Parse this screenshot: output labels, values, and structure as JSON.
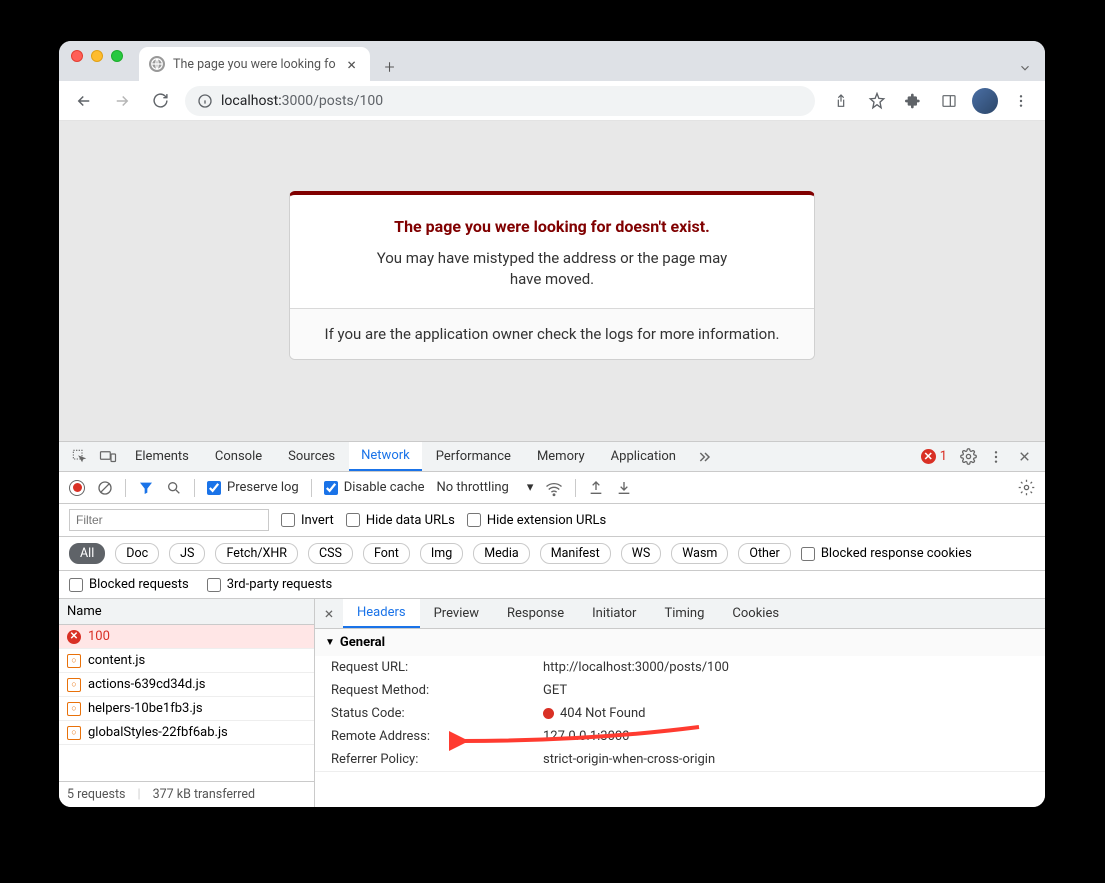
{
  "browser": {
    "tab_title": "The page you were looking fo",
    "url_host": "localhost:",
    "url_port_path": "3000/posts/100"
  },
  "page": {
    "heading": "The page you were looking for doesn't exist.",
    "body": "You may have mistyped the address or the page may have moved.",
    "footer": "If you are the application owner check the logs for more information."
  },
  "devtools": {
    "tabs": [
      "Elements",
      "Console",
      "Sources",
      "Network",
      "Performance",
      "Memory",
      "Application"
    ],
    "active_tab": "Network",
    "error_count": "1",
    "toolbar": {
      "preserve_log": "Preserve log",
      "disable_cache": "Disable cache",
      "throttling": "No throttling"
    },
    "filter": {
      "placeholder": "Filter",
      "invert": "Invert",
      "hide_data": "Hide data URLs",
      "hide_ext": "Hide extension URLs",
      "types": [
        "All",
        "Doc",
        "JS",
        "Fetch/XHR",
        "CSS",
        "Font",
        "Img",
        "Media",
        "Manifest",
        "WS",
        "Wasm",
        "Other"
      ],
      "blocked_cookies": "Blocked response cookies",
      "blocked_requests": "Blocked requests",
      "third_party": "3rd-party requests"
    },
    "column_name": "Name",
    "requests": [
      {
        "name": "100",
        "error": true
      },
      {
        "name": "content.js",
        "error": false
      },
      {
        "name": "actions-639cd34d.js",
        "error": false
      },
      {
        "name": "helpers-10be1fb3.js",
        "error": false
      },
      {
        "name": "globalStyles-22fbf6ab.js",
        "error": false
      }
    ],
    "summary": {
      "requests": "5 requests",
      "transferred": "377 kB transferred"
    },
    "detail": {
      "tabs": [
        "Headers",
        "Preview",
        "Response",
        "Initiator",
        "Timing",
        "Cookies"
      ],
      "general_label": "General",
      "fields": {
        "request_url_k": "Request URL:",
        "request_url_v": "http://localhost:3000/posts/100",
        "request_method_k": "Request Method:",
        "request_method_v": "GET",
        "status_code_k": "Status Code:",
        "status_code_v": "404 Not Found",
        "remote_addr_k": "Remote Address:",
        "remote_addr_v": "127.0.0.1:3000",
        "referrer_k": "Referrer Policy:",
        "referrer_v": "strict-origin-when-cross-origin"
      }
    }
  }
}
